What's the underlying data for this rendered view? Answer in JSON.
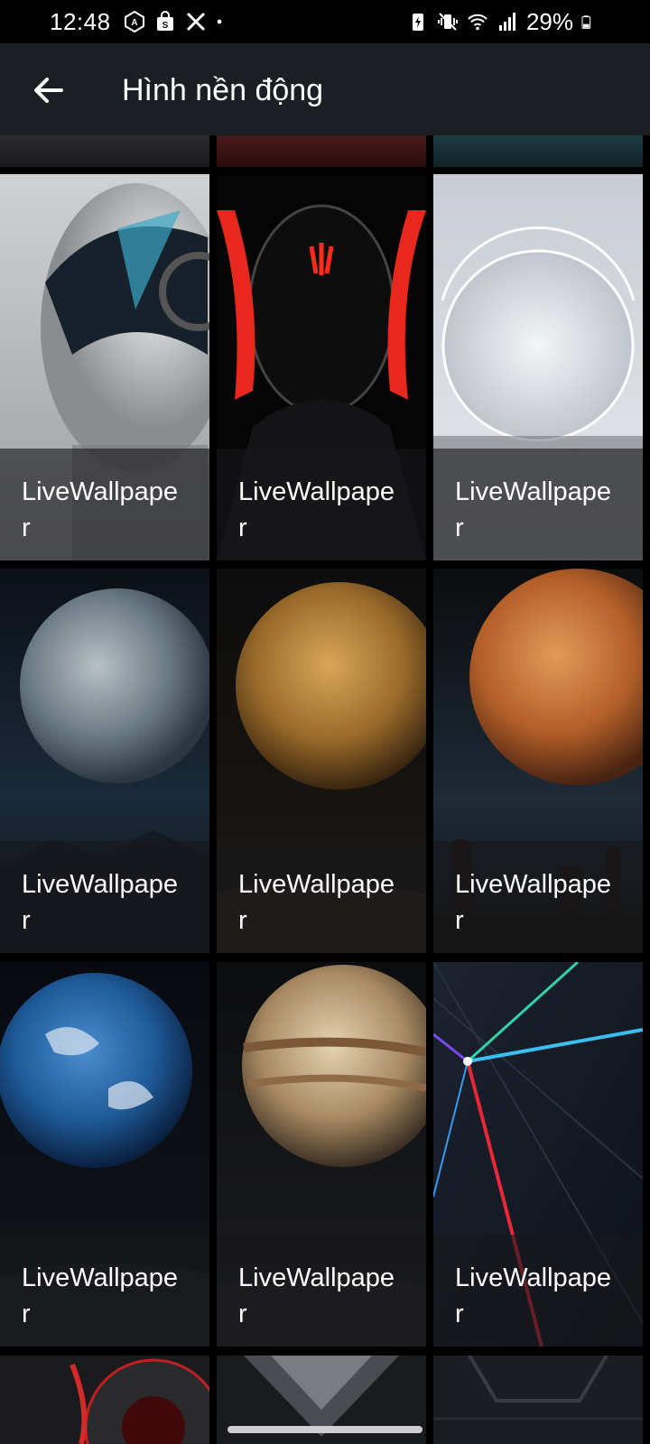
{
  "status_bar": {
    "time": "12:48",
    "battery": "29%",
    "left_icons": [
      "a-badge-icon",
      "shopping-bag-icon",
      "x-logo-icon",
      "dot-icon"
    ],
    "right_icons": [
      "battery-saver-icon",
      "vibrate-icon",
      "wifi-icon",
      "signal-icon",
      "battery-icon"
    ]
  },
  "app_bar": {
    "title": "Hình nền động",
    "back_icon": "arrow-back-icon"
  },
  "wallpapers": [
    {
      "label": "LiveWallpaper",
      "art": "silver-helmet"
    },
    {
      "label": "LiveWallpaper",
      "art": "red-black-helmet"
    },
    {
      "label": "LiveWallpaper",
      "art": "white-sphere"
    },
    {
      "label": "LiveWallpaper",
      "art": "grey-moon"
    },
    {
      "label": "LiveWallpaper",
      "art": "venus"
    },
    {
      "label": "LiveWallpaper",
      "art": "mars"
    },
    {
      "label": "LiveWallpaper",
      "art": "earth"
    },
    {
      "label": "LiveWallpaper",
      "art": "jupiter"
    },
    {
      "label": "LiveWallpaper",
      "art": "laser-rays"
    }
  ],
  "colors": {
    "background": "#000000",
    "app_bar": "#1b1e22",
    "caption_overlay": "#19191c",
    "text": "#ffffff"
  }
}
